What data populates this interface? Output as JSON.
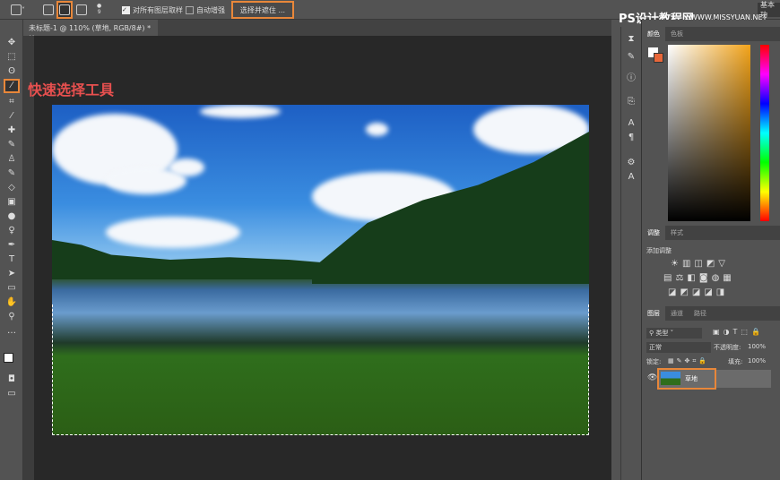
{
  "options_bar": {
    "sample_all_layers": "对所有图层取样",
    "auto_enhance": "自动增强",
    "select_and_mask": "选择并遮住 ...",
    "brush_size": "9",
    "workspace": "基本功"
  },
  "document_tab": {
    "title": "未标题-1 @ 110% (草地, RGB/8#) *",
    "close": "×"
  },
  "annotation": "快速选择工具",
  "watermark": {
    "name": "PS设计教程网",
    "url": "WWW.MISSYUAN.NET"
  },
  "color_panel": {
    "tabs": [
      "颜色",
      "色板"
    ],
    "foreground": "#ffffff",
    "background": "#e8673a"
  },
  "adjustments_panel": {
    "tabs": [
      "调整",
      "样式"
    ],
    "title": "添加调整"
  },
  "layers_panel": {
    "tabs": [
      "图层",
      "通道",
      "路径"
    ],
    "filter": "类型",
    "blend_mode": "正常",
    "opacity_label": "不透明度:",
    "opacity": "100%",
    "lock_label": "锁定:",
    "fill_label": "填充:",
    "fill": "100%",
    "layers": [
      {
        "name": "草地",
        "visible": true
      }
    ]
  }
}
